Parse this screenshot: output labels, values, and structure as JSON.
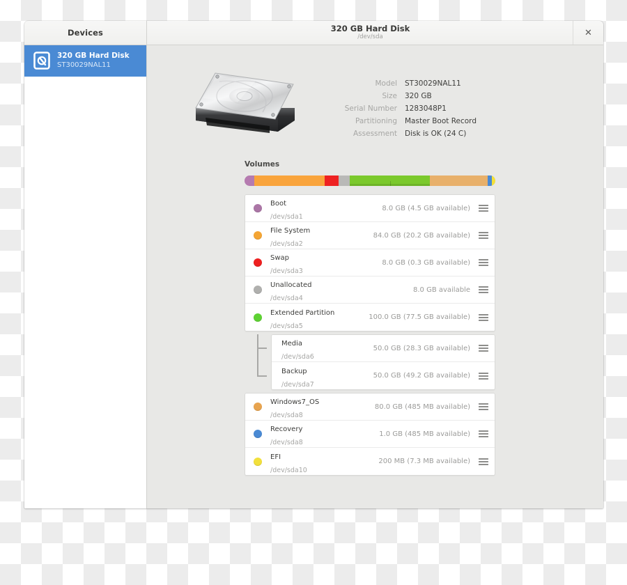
{
  "window": {
    "title": "320 GB Hard Disk",
    "subtitle": "/dev/sda",
    "close_label": "✕"
  },
  "sidebar": {
    "header": "Devices",
    "items": [
      {
        "name": "320 GB Hard Disk",
        "model": "ST30029NAL11",
        "icon": "hard-disk-icon",
        "selected": true
      }
    ]
  },
  "disk": {
    "illustration": "hard-disk-illustration",
    "properties": [
      {
        "key": "Model",
        "value": "ST30029NAL11"
      },
      {
        "key": "Size",
        "value": "320 GB"
      },
      {
        "key": "Serial Number",
        "value": "1283048P1"
      },
      {
        "key": "Partitioning",
        "value": "Master Boot Record"
      },
      {
        "key": "Assessment",
        "value": "Disk is OK (24 C)"
      }
    ]
  },
  "volumes": {
    "label": "Volumes",
    "bar_segments": [
      {
        "name": "Boot",
        "color": "#b57bb0",
        "percent": 4.0
      },
      {
        "name": "File System",
        "color": "#f9a43c",
        "percent": 28.0
      },
      {
        "name": "Swap",
        "color": "#ee2222",
        "percent": 5.5
      },
      {
        "name": "Unallocated",
        "color": "#b9b9b7",
        "percent": 4.5
      },
      {
        "name": "Extended Partition",
        "color": "#7bc92c",
        "percent": 32.0
      },
      {
        "name": "Windows7_OS",
        "color": "#e8b06a",
        "percent": 23.0
      },
      {
        "name": "Recovery",
        "color": "#4a8ad4",
        "percent": 1.5
      },
      {
        "name": "EFI",
        "color": "#f4e13a",
        "percent": 1.5
      }
    ],
    "rows": [
      {
        "name": "Boot",
        "device": "/dev/sda1",
        "size": "8.0 GB (4.5 GB available)",
        "color": "#ab76a6",
        "nested": false,
        "menu": "row-menu-icon"
      },
      {
        "name": "File System",
        "device": "/dev/sda2",
        "size": "84.0 GB (20.2 GB available)",
        "color": "#f4a534",
        "nested": false,
        "menu": "row-menu-icon"
      },
      {
        "name": "Swap",
        "device": "/dev/sda3",
        "size": "8.0 GB (0.3 GB available)",
        "color": "#ee2020",
        "nested": false,
        "menu": "row-menu-icon"
      },
      {
        "name": "Unallocated",
        "device": "/dev/sda4",
        "size": "8.0 GB available",
        "color": "#b0b0ae",
        "nested": false,
        "menu": "row-menu-icon"
      },
      {
        "name": "Extended Partition",
        "device": "/dev/sda5",
        "size": "100.0 GB (77.5 GB available)",
        "color": "#5ed233",
        "nested": false,
        "menu": "row-menu-icon"
      },
      {
        "name": "Media",
        "device": "/dev/sda6",
        "size": "50.0 GB (28.3 GB available)",
        "color": null,
        "nested": true,
        "menu": "row-menu-icon"
      },
      {
        "name": "Backup",
        "device": "/dev/sda7",
        "size": "50.0 GB (49.2 GB available)",
        "color": null,
        "nested": true,
        "menu": "row-menu-icon"
      },
      {
        "name": "Windows7_OS",
        "device": "/dev/sda8",
        "size": "80.0 GB (485 MB available)",
        "color": "#e8a44f",
        "nested": false,
        "menu": "row-menu-icon"
      },
      {
        "name": "Recovery",
        "device": "/dev/sda8",
        "size": "1.0 GB (485 MB available)",
        "color": "#4a8ad4",
        "nested": false,
        "menu": "row-menu-icon"
      },
      {
        "name": "EFI",
        "device": "/dev/sda10",
        "size": "200 MB (7.3 MB available)",
        "color": "#f2e03c",
        "nested": false,
        "menu": "row-menu-icon"
      }
    ]
  },
  "theme": {
    "accent": "#4a8ad4",
    "window_bg": "#e8e8e6",
    "titlebar_bg": "#f2f2f0"
  }
}
